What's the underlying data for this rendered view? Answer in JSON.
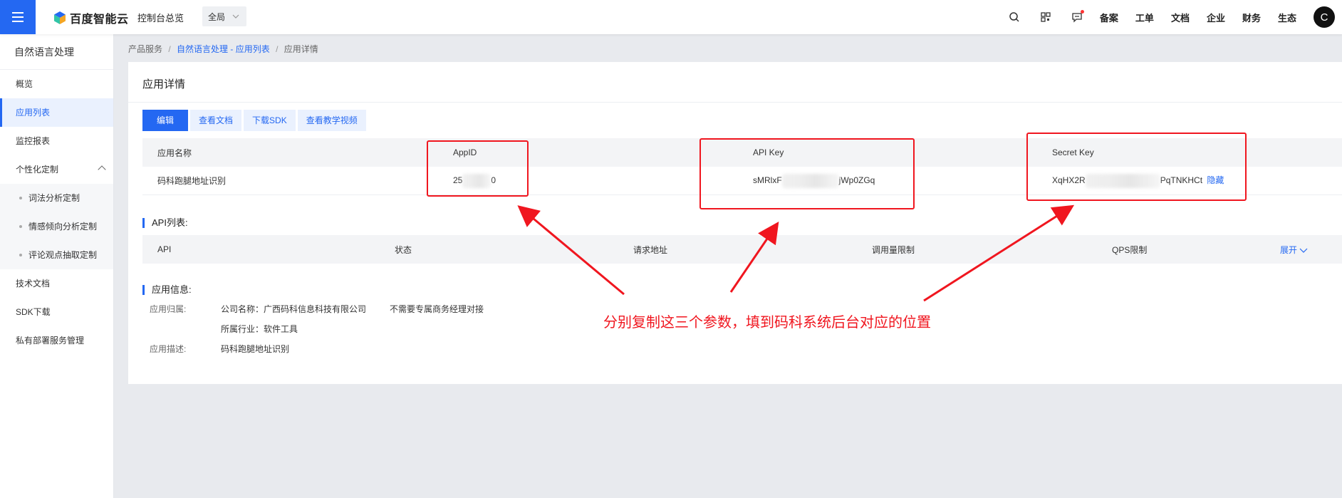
{
  "topbar": {
    "logo_text": "百度智能云",
    "overview": "控制台总览",
    "region": "全局",
    "links": [
      "备案",
      "工单",
      "文档",
      "企业",
      "财务",
      "生态"
    ],
    "avatar": "C",
    "icons": [
      "search-icon",
      "qrcode-icon",
      "message-icon"
    ]
  },
  "sidebar": {
    "title": "自然语言处理",
    "items": [
      {
        "label": "概览"
      },
      {
        "label": "应用列表",
        "active": true
      },
      {
        "label": "监控报表"
      },
      {
        "label": "个性化定制"
      },
      {
        "label": "词法分析定制"
      },
      {
        "label": "情感倾向分析定制"
      },
      {
        "label": "评论观点抽取定制"
      },
      {
        "label": "技术文档"
      },
      {
        "label": "SDK下载"
      },
      {
        "label": "私有部署服务管理"
      }
    ]
  },
  "breadcrumb": {
    "root": "产品服务",
    "sep": "/",
    "link": "自然语言处理 - 应用列表",
    "current": "应用详情"
  },
  "panel": {
    "title": "应用详情",
    "buttons": [
      "编辑",
      "查看文档",
      "下载SDK",
      "查看教学视频"
    ],
    "app_table": {
      "headers": [
        "应用名称",
        "AppID",
        "API Key",
        "Secret Key"
      ],
      "row": {
        "name": "码科跑腿地址识别",
        "appid_prefix": "25",
        "appid_suffix": "0",
        "apikey_prefix": "sMRlxF",
        "apikey_suffix": "jWp0ZGq",
        "secret_prefix": "XqHX2R",
        "secret_suffix": "PqTNKHCt",
        "hide_link": "隐藏"
      }
    },
    "api_section": "API列表:",
    "api_table": {
      "headers": [
        "API",
        "状态",
        "请求地址",
        "调用量限制",
        "QPS限制"
      ],
      "expand": "展开"
    },
    "info_section": "应用信息:",
    "info": {
      "owner_label": "应用归属:",
      "company": "公司名称：广西码科信息科技有限公司",
      "manager": "不需要专属商务经理对接",
      "industry": "所属行业：软件工具",
      "desc_label": "应用描述:",
      "desc": "码科跑腿地址识别"
    }
  },
  "annotation": "分别复制这三个参数，填到码科系统后台对应的位置",
  "colors": {
    "brand": "#2468f2",
    "annotation_red": "#f0161f"
  }
}
